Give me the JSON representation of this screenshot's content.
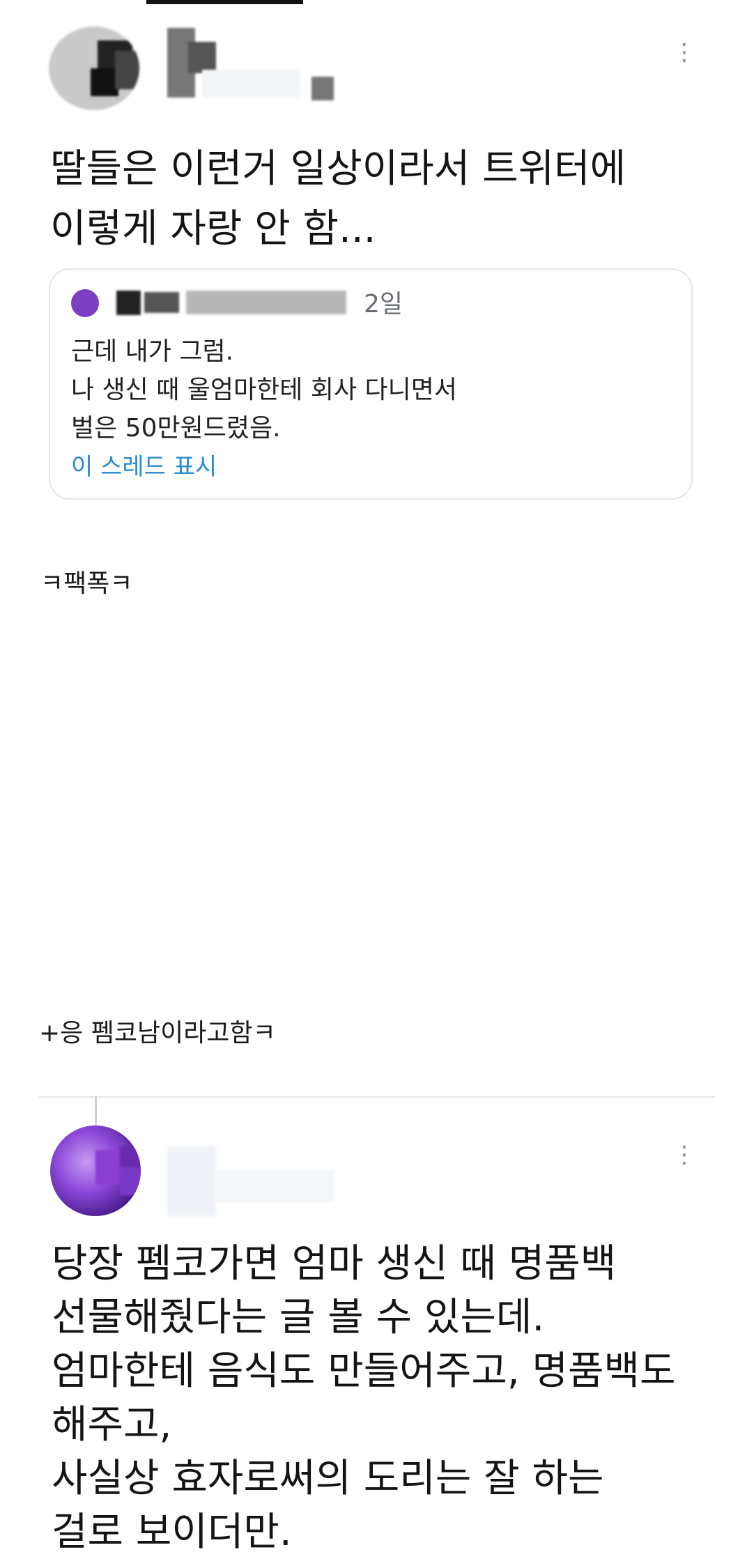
{
  "tweet1": {
    "menu_icon": "⋮",
    "lines": [
      "딸들은 이런거 일상이라서 트위터에",
      "이렇게 자랑 안 함..."
    ],
    "quote": {
      "time": "2일",
      "lines": [
        "근데 내가 그럼.",
        "나 생신 때 울엄마한테 회사 다니면서",
        "벌은 50만원드렸음."
      ],
      "link": "이 스레드 표시"
    }
  },
  "caption1": "ㅋ팩폭ㅋ",
  "caption2": "+응 펨코남이라고함ㅋ",
  "tweet2": {
    "menu_icon": "⋮",
    "lines": [
      "당장 펨코가면 엄마 생신 때 명품백",
      "선물해줬다는 글 볼 수 있는데.",
      "엄마한테 음식도 만들어주고, 명품백도",
      "해주고,",
      "사실상 효자로써의 도리는 잘 하는",
      "걸로 보이더만."
    ]
  },
  "colors": {
    "link": "#2a8bd0",
    "avatar_accent": "#7b3fc4",
    "time": "#6a6f75"
  }
}
